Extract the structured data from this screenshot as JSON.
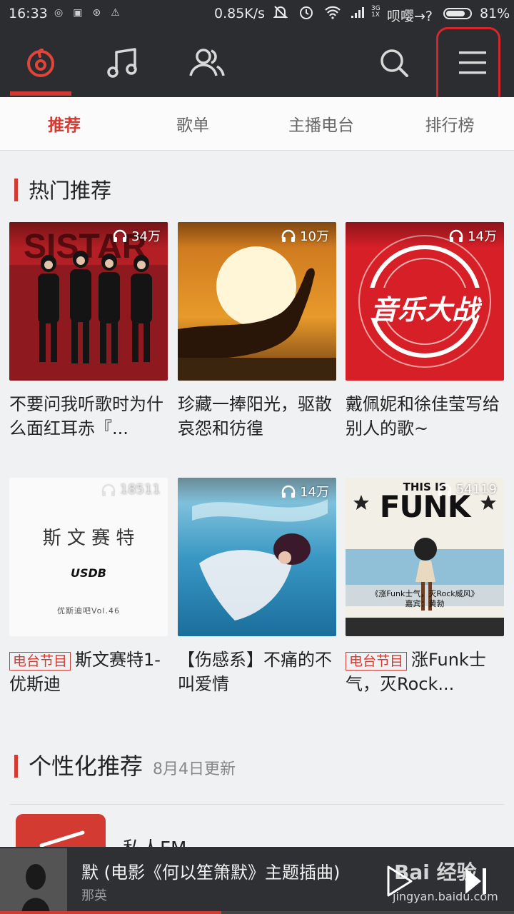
{
  "status_bar": {
    "time": "16:33",
    "speed": "0.85K/s",
    "carrier": "呗嘤→?",
    "battery_percent_text": "81%",
    "battery_level": 0.81,
    "network_small_top": "3G",
    "network_small_bottom": "1X"
  },
  "top_nav": {
    "items": [
      {
        "name": "discover",
        "icon": "netease-logo-icon",
        "active": true
      },
      {
        "name": "my-music",
        "icon": "music-note-icon",
        "active": false
      },
      {
        "name": "friends",
        "icon": "friends-icon",
        "active": false
      }
    ],
    "search_icon": "search-icon",
    "menu_icon": "menu-icon",
    "accent": "#d33a31"
  },
  "sub_tabs": [
    {
      "label": "推荐",
      "active": true
    },
    {
      "label": "歌单",
      "active": false
    },
    {
      "label": "主播电台",
      "active": false
    },
    {
      "label": "排行榜",
      "active": false
    }
  ],
  "hot_section": {
    "title": "热门推荐",
    "cards": [
      {
        "count": "34万",
        "title": "不要问我听歌时为什么面红耳赤『...",
        "tag": ""
      },
      {
        "count": "10万",
        "title": "珍藏一捧阳光，驱散哀怨和彷徨",
        "tag": ""
      },
      {
        "count": "14万",
        "title": "戴佩妮和徐佳莹写给别人的歌~",
        "tag": "",
        "cover_text": "音乐大战"
      },
      {
        "count": "18511",
        "title": "斯文赛特1-优斯迪",
        "tag": "电台节目",
        "cover_text": "斯 文 赛 特",
        "cover_sub": "优斯迪吧Vol.46",
        "cover_logo": "USDB"
      },
      {
        "count": "14万",
        "title": "【伤感系】不痛的不叫爱情",
        "tag": ""
      },
      {
        "count": "54119",
        "title": "涨Funk士气，灭Rock...",
        "tag": "电台节目",
        "cover_text_top": "THIS IS",
        "cover_text": "FUNK",
        "cover_caption": "《涨Funk士气，灭Rock威风》",
        "cover_caption2": "嘉宾：黄勃"
      }
    ]
  },
  "personal_section": {
    "title": "个性化推荐",
    "subtitle": "8月4日更新",
    "first_item_label": "私人FM"
  },
  "player": {
    "title": "默 (电影《何以笙箫默》主题插曲)",
    "artist": "那英",
    "progress": 0.43
  },
  "watermark": {
    "text": "Bai 经验",
    "url": "jingyan.baidu.com"
  }
}
